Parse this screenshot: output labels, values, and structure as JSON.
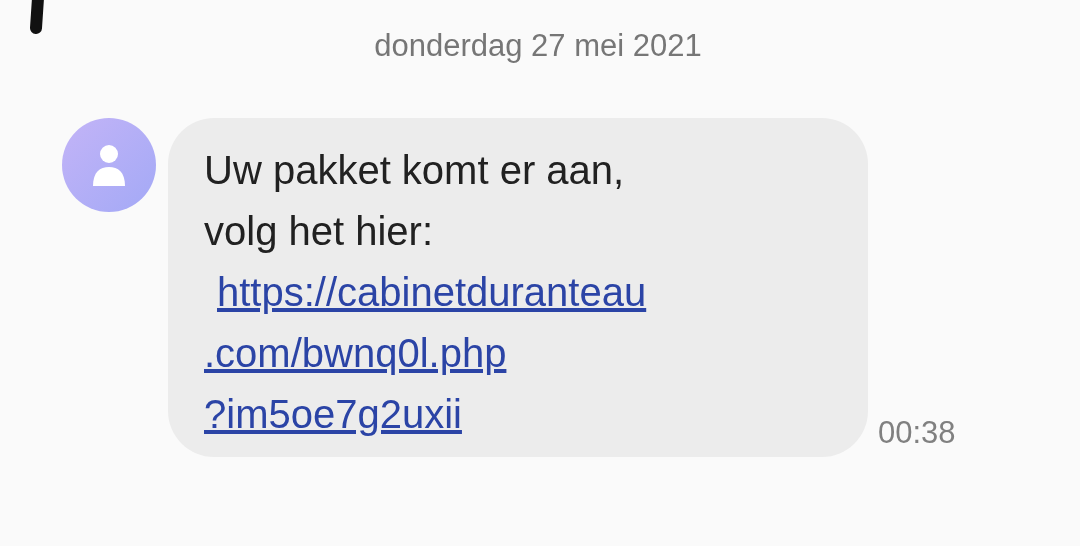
{
  "date_separator": "donderdag 27 mei 2021",
  "message": {
    "text_lines": [
      "Uw pakket komt er aan,",
      "volg het hier:"
    ],
    "link_lines": [
      "https://cabinetduranteau",
      ".com/bwnq0l.php",
      "?im5oe7g2uxii"
    ],
    "time": "00:38"
  }
}
